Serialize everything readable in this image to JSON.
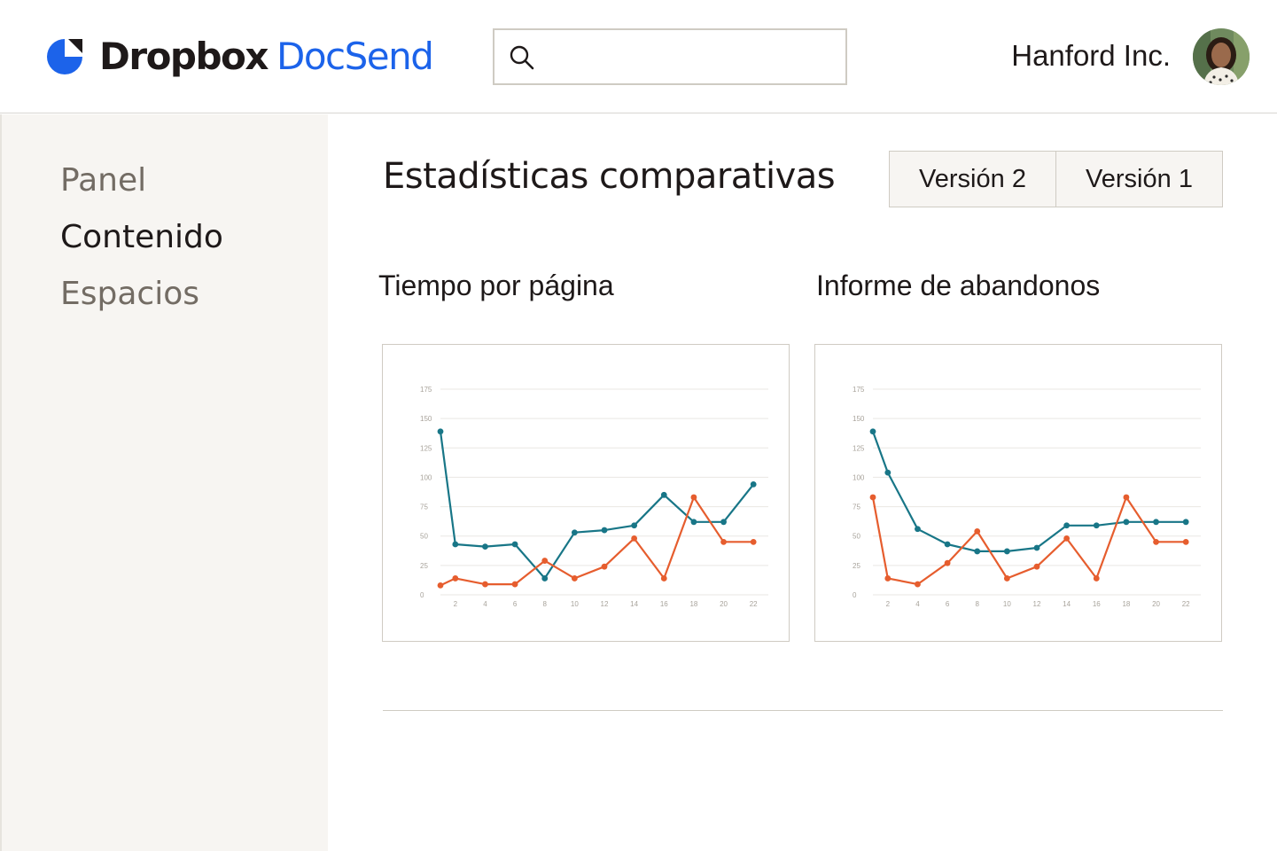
{
  "header": {
    "brand_part1": "Dropbox",
    "brand_part2": "DocSend",
    "search": {
      "placeholder": "",
      "value": ""
    },
    "company": "Hanford Inc."
  },
  "sidebar": {
    "items": [
      {
        "label": "Panel",
        "active": false
      },
      {
        "label": "Contenido",
        "active": true
      },
      {
        "label": "Espacios",
        "active": false
      }
    ]
  },
  "main": {
    "title": "Estadísticas comparativas",
    "versions": [
      "Versión 2",
      "Versión 1"
    ]
  },
  "colors": {
    "brand_blue": "#1c63ea",
    "series_teal": "#187687",
    "series_orange": "#e65d2e",
    "sidebar_bg": "#f7f5f2"
  },
  "chart_data": [
    {
      "type": "line",
      "title": "Tiempo por página",
      "ylim": [
        0,
        175
      ],
      "y_ticks": [
        0,
        25,
        50,
        75,
        100,
        125,
        150,
        175
      ],
      "x_ticks": [
        2,
        4,
        6,
        8,
        10,
        12,
        14,
        16,
        18,
        20,
        22
      ],
      "grid": true,
      "x": [
        1,
        2,
        4,
        6,
        8,
        10,
        12,
        14,
        16,
        18,
        20,
        22
      ],
      "series": [
        {
          "color": "#187687",
          "values": [
            139,
            43,
            41,
            43,
            14,
            53,
            55,
            59,
            85,
            62,
            62,
            94
          ]
        },
        {
          "color": "#e65d2e",
          "values": [
            8,
            14,
            9,
            9,
            29,
            14,
            24,
            48,
            14,
            83,
            45,
            45
          ]
        }
      ]
    },
    {
      "type": "line",
      "title": "Informe de abandonos",
      "ylim": [
        0,
        175
      ],
      "y_ticks": [
        0,
        25,
        50,
        75,
        100,
        125,
        150,
        175
      ],
      "x_ticks": [
        2,
        4,
        6,
        8,
        10,
        12,
        14,
        16,
        18,
        20,
        22
      ],
      "grid": true,
      "x": [
        1,
        2,
        4,
        6,
        8,
        10,
        12,
        14,
        16,
        18,
        20,
        22
      ],
      "series": [
        {
          "color": "#187687",
          "values": [
            139,
            104,
            56,
            43,
            37,
            37,
            40,
            59,
            59,
            62,
            62,
            62
          ]
        },
        {
          "color": "#e65d2e",
          "values": [
            83,
            14,
            9,
            27,
            54,
            14,
            24,
            48,
            14,
            83,
            45,
            45
          ]
        }
      ]
    }
  ]
}
